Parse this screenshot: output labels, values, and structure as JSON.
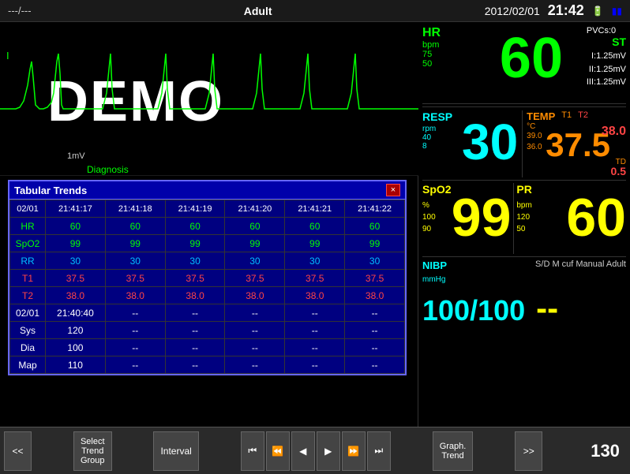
{
  "topbar": {
    "left": "---/---",
    "center": "Adult",
    "date": "2012/02/01",
    "time": "21:42",
    "battery": "🔋"
  },
  "ecg": {
    "lead": "I",
    "demo_text": "DEMO",
    "scale": "1mV",
    "diagnosis": "Diagnosis"
  },
  "dialog": {
    "title": "Tabular Trends",
    "close": "×",
    "headers": [
      "02/01",
      "21:41:17",
      "21:41:18",
      "21:41:19",
      "21:41:20",
      "21:41:21",
      "21:41:22"
    ],
    "rows": [
      {
        "label": "HR",
        "values": [
          "60",
          "60",
          "60",
          "60",
          "60",
          "60"
        ],
        "class": "row-hr"
      },
      {
        "label": "SpO2",
        "values": [
          "99",
          "99",
          "99",
          "99",
          "99",
          "99"
        ],
        "class": "row-spo2"
      },
      {
        "label": "RR",
        "values": [
          "30",
          "30",
          "30",
          "30",
          "30",
          "30"
        ],
        "class": "row-rr"
      },
      {
        "label": "T1",
        "values": [
          "37.5",
          "37.5",
          "37.5",
          "37.5",
          "37.5",
          "37.5"
        ],
        "class": "row-t1"
      },
      {
        "label": "T2",
        "values": [
          "38.0",
          "38.0",
          "38.0",
          "38.0",
          "38.0",
          "38.0"
        ],
        "class": "row-t2"
      },
      {
        "label": "02/01",
        "values": [
          "21:40:40",
          "--",
          "--",
          "--",
          "--",
          "--"
        ],
        "class": "row-date2"
      },
      {
        "label": "Sys",
        "values": [
          "120",
          "--",
          "--",
          "--",
          "--",
          "--"
        ],
        "class": "row-sys"
      },
      {
        "label": "Dia",
        "values": [
          "100",
          "--",
          "--",
          "--",
          "--",
          "--"
        ],
        "class": "row-dia"
      },
      {
        "label": "Map",
        "values": [
          "110",
          "--",
          "--",
          "--",
          "--",
          "--"
        ],
        "class": "row-map"
      }
    ]
  },
  "vitals": {
    "hr": {
      "label": "HR",
      "unit": "bpm",
      "value": "60",
      "scale_high": "75",
      "scale_low": "50",
      "st_label": "ST",
      "pvcs": "PVCs:0",
      "st_i": "I:1.25mV",
      "st_ii": "II:1.25mV",
      "st_iii": "III:1.25mV"
    },
    "resp": {
      "label": "RESP",
      "unit": "rpm",
      "value": "30",
      "scale_high": "40",
      "scale_low": "8"
    },
    "temp": {
      "label": "TEMP",
      "t1": "T1",
      "t2": "T2",
      "unit": "°C",
      "value": "37.5",
      "t2_value": "38.0",
      "scale_high": "39.0",
      "scale_low": "36.0",
      "td_label": "TD",
      "td_value": "0.5"
    },
    "spo2": {
      "label": "SpO2",
      "unit": "%",
      "value": "99",
      "scale_high": "100",
      "scale_low": "90"
    },
    "pr": {
      "label": "PR",
      "unit": "bpm",
      "value": "60",
      "scale_high": "120",
      "scale_low": "50"
    },
    "nibp": {
      "label": "NIBP",
      "info": "S/D M cuf Manual Adult",
      "unit": "mmHg",
      "value": "100/100",
      "dash": "--"
    }
  },
  "toolbar": {
    "prev_btn": "<<",
    "select_trend": "Select\nTrend\nGroup",
    "interval": "Interval",
    "nav_first": "⏮",
    "nav_prev_fast": "⏪",
    "nav_prev": "◀",
    "nav_next": "▶",
    "nav_next_fast": "⏩",
    "nav_last": "⏭",
    "graph_trend": "Graph.\nTrend",
    "next_btn": ">>",
    "right_num": "130"
  }
}
